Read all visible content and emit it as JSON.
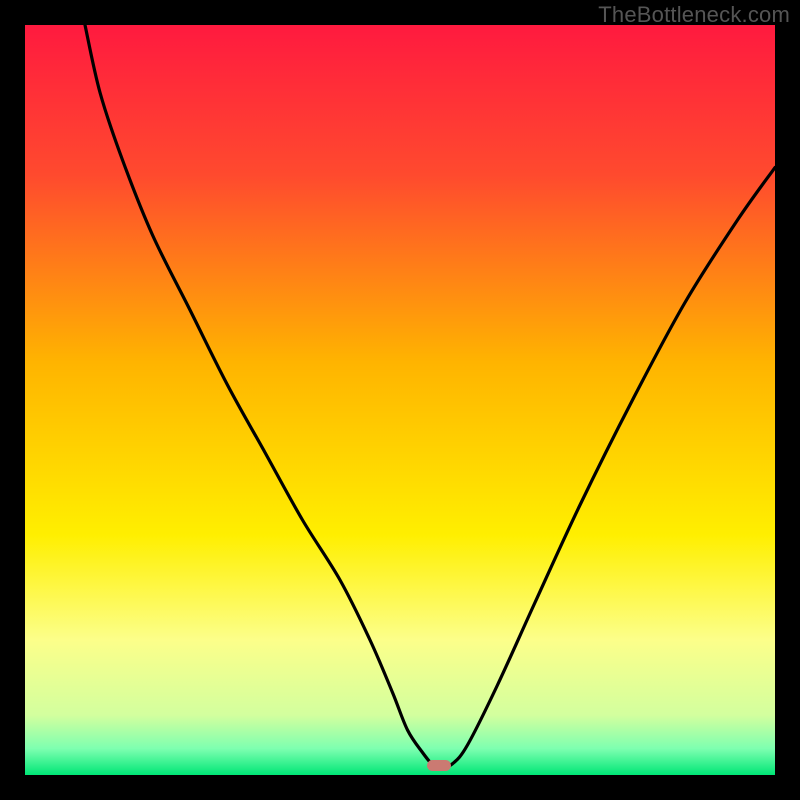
{
  "watermark": "TheBottleneck.com",
  "chart_data": {
    "type": "line",
    "title": "",
    "xlabel": "",
    "ylabel": "",
    "xlim": [
      0,
      100
    ],
    "ylim": [
      0,
      100
    ],
    "grid": false,
    "legend": false,
    "gradient_stops": [
      {
        "offset": 0.0,
        "color": "#ff1a3f"
      },
      {
        "offset": 0.2,
        "color": "#ff4a2e"
      },
      {
        "offset": 0.45,
        "color": "#ffb400"
      },
      {
        "offset": 0.68,
        "color": "#ffef00"
      },
      {
        "offset": 0.82,
        "color": "#fcff8a"
      },
      {
        "offset": 0.92,
        "color": "#d3ff9e"
      },
      {
        "offset": 0.965,
        "color": "#7dffb0"
      },
      {
        "offset": 1.0,
        "color": "#00e676"
      }
    ],
    "series": [
      {
        "name": "bottleneck-curve",
        "x": [
          8,
          10,
          13,
          17,
          22,
          27,
          32,
          37,
          42,
          46,
          49,
          51,
          53,
          54.5,
          55.5,
          57,
          59,
          63,
          68,
          74,
          81,
          88,
          95,
          100
        ],
        "y": [
          100,
          91,
          82,
          72,
          62,
          52,
          43,
          34,
          26,
          18,
          11,
          6,
          3,
          1.2,
          1.0,
          1.5,
          4,
          12,
          23,
          36,
          50,
          63,
          74,
          81
        ]
      }
    ],
    "marker": {
      "x": 55.2,
      "y": 1.3,
      "w": 3.2,
      "h": 1.5,
      "color": "#cb7a72"
    }
  }
}
